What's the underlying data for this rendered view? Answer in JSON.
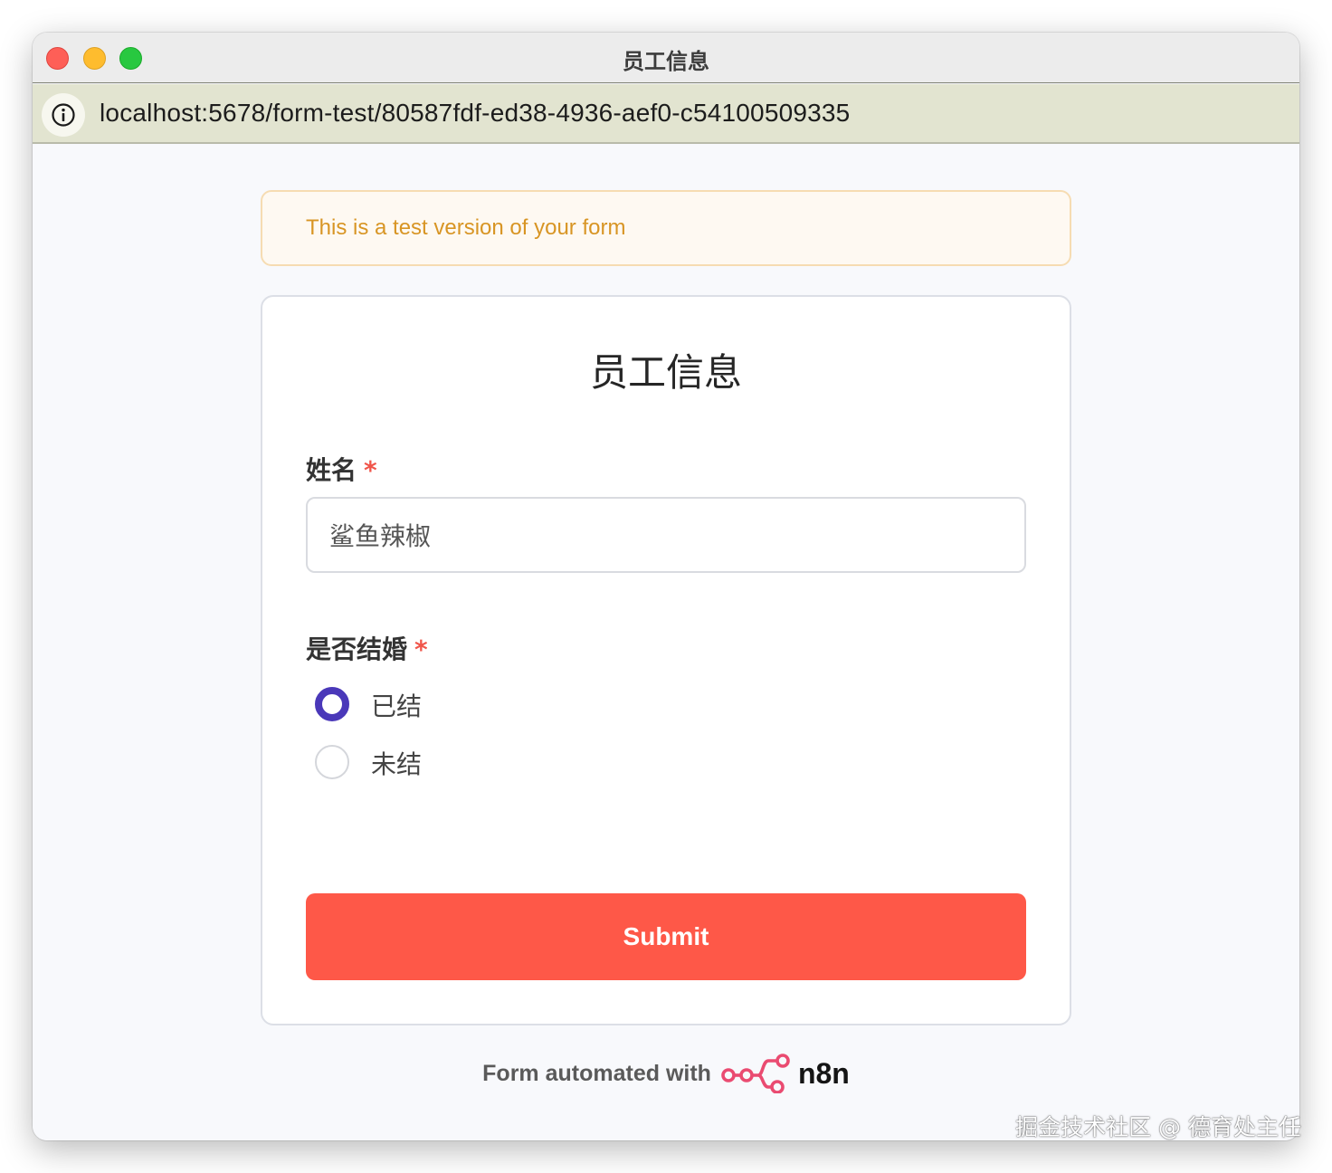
{
  "window": {
    "title": "员工信息"
  },
  "address_bar": {
    "url": "localhost:5678/form-test/80587fdf-ed38-4936-aef0-c54100509335",
    "icon": "info-icon"
  },
  "banner": {
    "text": "This is a test version of your form"
  },
  "form": {
    "title": "员工信息",
    "fields": [
      {
        "label": "姓名",
        "required_marker": "*",
        "value": "鲨鱼辣椒"
      },
      {
        "label": "是否结婚",
        "required_marker": "*",
        "options": [
          {
            "label": "已结",
            "selected": true
          },
          {
            "label": "未结",
            "selected": false
          }
        ]
      }
    ],
    "submit_label": "Submit"
  },
  "footer": {
    "text": "Form automated with",
    "brand": "n8n"
  },
  "watermark": "掘金技术社区 @ 德育处主任",
  "colors": {
    "accent_radio": "#4a38b9",
    "submit_bg": "#fe5848",
    "required": "#f0554a",
    "banner_text": "#d89524",
    "n8n_logo": "#ea4b71"
  }
}
